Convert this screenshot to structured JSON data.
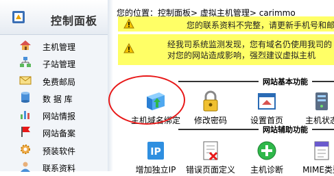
{
  "sidebar": {
    "title": "控制面板",
    "items": [
      {
        "label": "主机管理",
        "icon": "house-icon"
      },
      {
        "label": "子站管理",
        "icon": "network-icon"
      },
      {
        "label": "免费邮局",
        "icon": "mail-icon"
      },
      {
        "label": "数 据 库",
        "icon": "database-icon"
      },
      {
        "label": "网站情报",
        "icon": "bar-chart-icon"
      },
      {
        "label": "网站备案",
        "icon": "flag-icon"
      },
      {
        "label": "预装软件",
        "icon": "gear-icon"
      },
      {
        "label": "联系资料",
        "icon": "contact-icon"
      }
    ]
  },
  "breadcrumb": "您的位置：控制面板> 虚拟主机管理> carimmo",
  "notices": {
    "incomplete": "您的联系资料不完整，请更新手机号和邮件",
    "monitor_line1": "经我司系统监测发现，您有域名仍使用我司的",
    "monitor_line2": "对您的网站造成影响，强烈建议虚拟主机"
  },
  "sections": {
    "basic": "网站基本功能",
    "aux": "网站辅助功能"
  },
  "basic_tiles": [
    {
      "label": "主机域名绑定",
      "icon": "domain-bind-icon"
    },
    {
      "label": "修改密码",
      "icon": "lock-icon"
    },
    {
      "label": "设置首页",
      "icon": "home-page-icon"
    },
    {
      "label": "主机状态",
      "icon": "server-status-icon"
    }
  ],
  "aux_tiles": [
    {
      "label": "增加独立IP",
      "icon": "ip-icon"
    },
    {
      "label": "错误页面定义",
      "icon": "error-page-icon"
    },
    {
      "label": "主机诊断",
      "icon": "diagnose-plus-icon"
    },
    {
      "label": "MIME类型",
      "icon": "mime-icon"
    }
  ],
  "colors": {
    "notice_bg": "#ffff66",
    "highlight_circle": "#e81818",
    "sidebar_bg": "#f2f5f9"
  }
}
